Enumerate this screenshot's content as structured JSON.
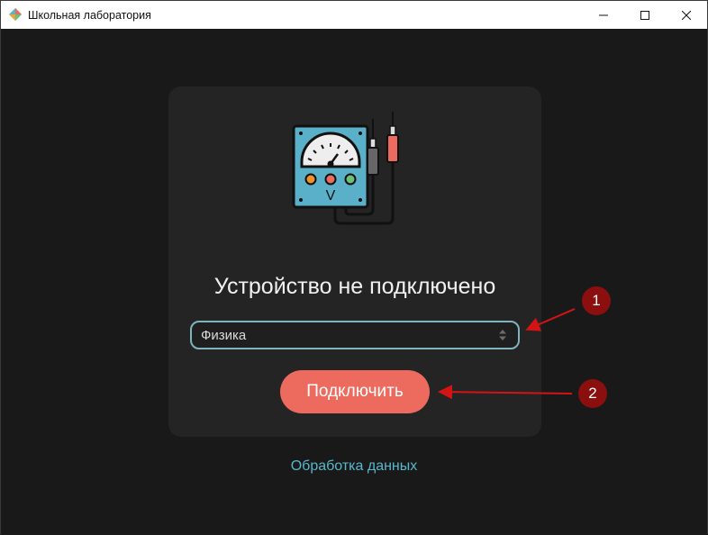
{
  "window": {
    "title": "Школьная лаборатория",
    "controls": [
      "minimize",
      "maximize",
      "close"
    ]
  },
  "main": {
    "illustration_icon": "voltmeter-with-probes-icon",
    "meter_unit_label": "V",
    "status_title": "Устройство не подключено",
    "subject_select": {
      "value": "Физика"
    },
    "connect_button": "Подключить",
    "data_link": "Обработка данных"
  },
  "annotations": {
    "markers": [
      "1",
      "2"
    ]
  },
  "colors": {
    "background": "#191919",
    "card": "#242424",
    "accent_button": "#ec6b5e",
    "link": "#58b7cc",
    "select_border": "#7fb3bd",
    "annotation": "#8b0f0f"
  }
}
